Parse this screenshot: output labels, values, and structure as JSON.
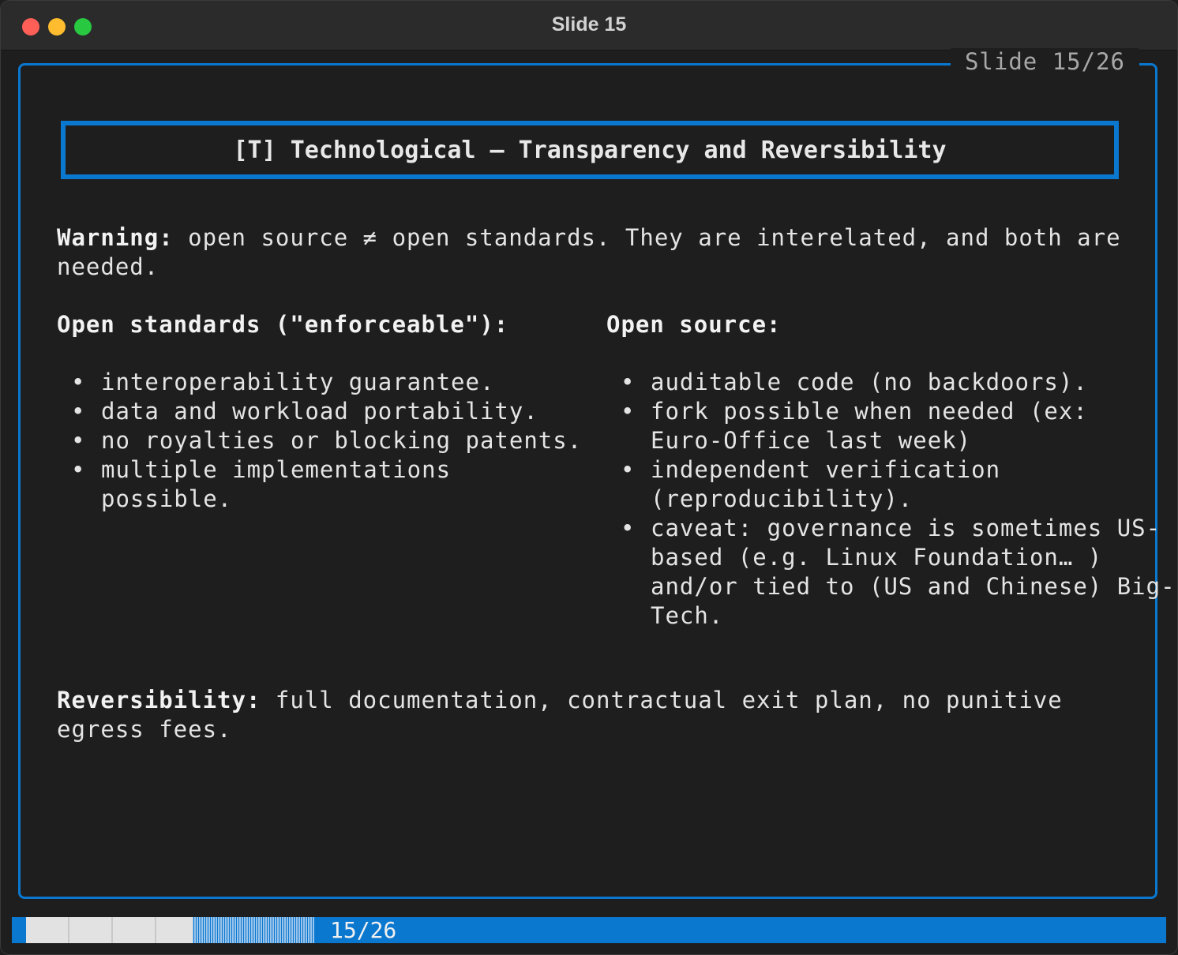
{
  "window": {
    "title": "Slide 15"
  },
  "slide": {
    "frame_label": "Slide 15/26",
    "title": "[T] Technological — Transparency and Reversibility",
    "warning_label": "Warning:",
    "warning_text": " open source ≠ open standards. They are interelated, and both are needed.",
    "left_heading": "Open standards (\"enforceable\"):",
    "left_items": [
      "interoperability guarantee.",
      "data and workload portability.",
      "no royalties or blocking patents.",
      "multiple implementations possible."
    ],
    "right_heading": "Open source:",
    "right_items": [
      "auditable code (no backdoors).",
      "fork possible when needed (ex: Euro-Office last week)",
      "independent verification (reproducibility).",
      "caveat: governance is sometimes US-based (e.g. Linux Foundation… ) and/or tied to (US and Chinese) Big-Tech."
    ],
    "bullet": "•",
    "reversibility_label": "Reversibility:",
    "reversibility_text": " full documentation, contractual exit plan, no punitive egress fees."
  },
  "statusbar": {
    "progress_text": "15/26",
    "progress_fraction": 0.5769
  },
  "colors": {
    "accent": "#0b78d0",
    "background": "#1e1e1e",
    "text": "#e4e4e4"
  }
}
